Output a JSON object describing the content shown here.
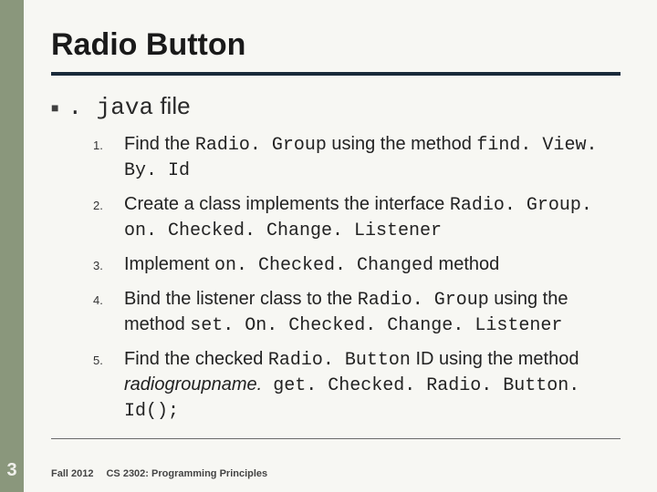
{
  "slide": {
    "title": "Radio Button",
    "sub_prefix": ". java",
    "sub_suffix": " file",
    "items": [
      {
        "n": "1.",
        "parts": [
          {
            "t": "Find the ",
            "c": false
          },
          {
            "t": "Radio. Group",
            "c": true
          },
          {
            "t": " using the method ",
            "c": false
          },
          {
            "t": "find. View. By. Id",
            "c": true
          }
        ]
      },
      {
        "n": "2.",
        "parts": [
          {
            "t": "Create a class implements the interface ",
            "c": false
          },
          {
            "t": "Radio. Group. on. Checked. Change. Listener",
            "c": true
          }
        ]
      },
      {
        "n": "3.",
        "parts": [
          {
            "t": "Implement ",
            "c": false
          },
          {
            "t": "on. Checked. Changed",
            "c": true
          },
          {
            "t": " method",
            "c": false
          }
        ]
      },
      {
        "n": "4.",
        "parts": [
          {
            "t": "Bind the listener class to the ",
            "c": false
          },
          {
            "t": "Radio. Group",
            "c": true
          },
          {
            "t": " using the method ",
            "c": false
          },
          {
            "t": "set. On. Checked. Change. Listener",
            "c": true
          }
        ]
      },
      {
        "n": "5.",
        "parts": [
          {
            "t": "Find the checked ",
            "c": false
          },
          {
            "t": "Radio. Button",
            "c": true
          },
          {
            "t": " ID using the method ",
            "c": false
          },
          {
            "t": "radiogroupname.",
            "c": false,
            "i": true
          },
          {
            "t": " get. Checked. Radio. Button. Id();",
            "c": true
          }
        ]
      }
    ],
    "page_number": "3",
    "footer_left": "Fall 2012",
    "footer_right": "CS 2302: Programming Principles"
  }
}
